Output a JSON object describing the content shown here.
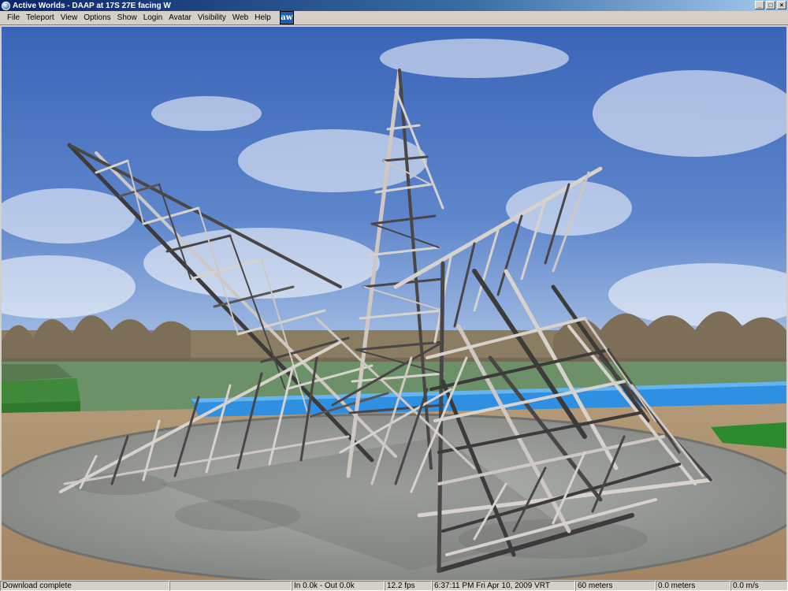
{
  "window": {
    "title": "Active Worlds - DAAP at 17S 27E facing W",
    "minimize": "_",
    "maximize": "□",
    "close": "×"
  },
  "menu": [
    "File",
    "Teleport",
    "View",
    "Options",
    "Show",
    "Login",
    "Avatar",
    "Visibility",
    "Web",
    "Help"
  ],
  "logo_text": "aw",
  "status": {
    "message": "Download complete",
    "io": "In  0.0k - Out  0.0k",
    "fps": "12.2 fps",
    "clock": "6:37:11 PM Fri Apr 10, 2009 VRT",
    "distance": "60 meters",
    "altitude": "0.0 meters",
    "speed": "0.0 m/s"
  },
  "colors": {
    "sky_top": "#3a64b8",
    "sky_bottom": "#a9c2e6",
    "grass": "#6c9068",
    "water": "#2f8fe0",
    "plaza": "#9a9d9a",
    "steel_light": "#d8d2cc",
    "steel_dark": "#4a4646"
  }
}
